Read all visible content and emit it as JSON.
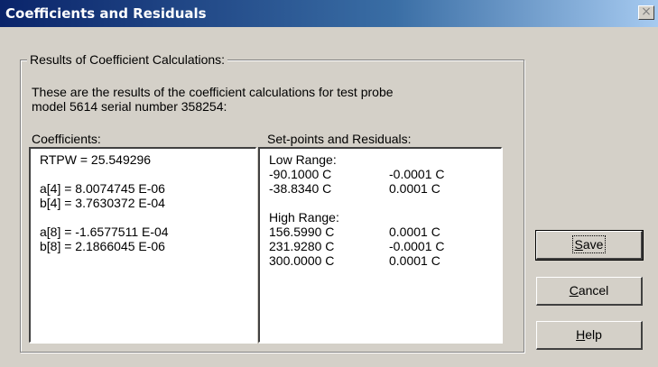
{
  "window": {
    "title": "Coefficients and Residuals",
    "close_symbol": "×"
  },
  "group": {
    "legend": "Results of Coefficient Calculations:",
    "description_line1": "These are the results of the coefficient calculations for test probe",
    "description_line2": "model 5614 serial number 358254:"
  },
  "coefficients": {
    "label": "Coefficients:",
    "lines": [
      "RTPW = 25.549296",
      "a[4] = 8.0074745 E-06",
      "b[4] = 3.7630372 E-04",
      "a[8] = -1.6577511 E-04",
      "b[8] = 2.1866045 E-06"
    ]
  },
  "residuals": {
    "label": "Set-points and Residuals:",
    "low_label": "Low Range:",
    "low": [
      {
        "setpoint": "-90.1000 C",
        "residual": "-0.0001 C"
      },
      {
        "setpoint": "-38.8340 C",
        "residual": "0.0001 C"
      }
    ],
    "high_label": "High Range:",
    "high": [
      {
        "setpoint": "156.5990 C",
        "residual": "0.0001 C"
      },
      {
        "setpoint": "231.9280 C",
        "residual": "-0.0001 C"
      },
      {
        "setpoint": "300.0000 C",
        "residual": "0.0001 C"
      }
    ]
  },
  "buttons": {
    "save_mnemonic": "S",
    "save_rest": "ave",
    "cancel_mnemonic": "C",
    "cancel_rest": "ancel",
    "help_mnemonic": "H",
    "help_rest": "elp"
  }
}
